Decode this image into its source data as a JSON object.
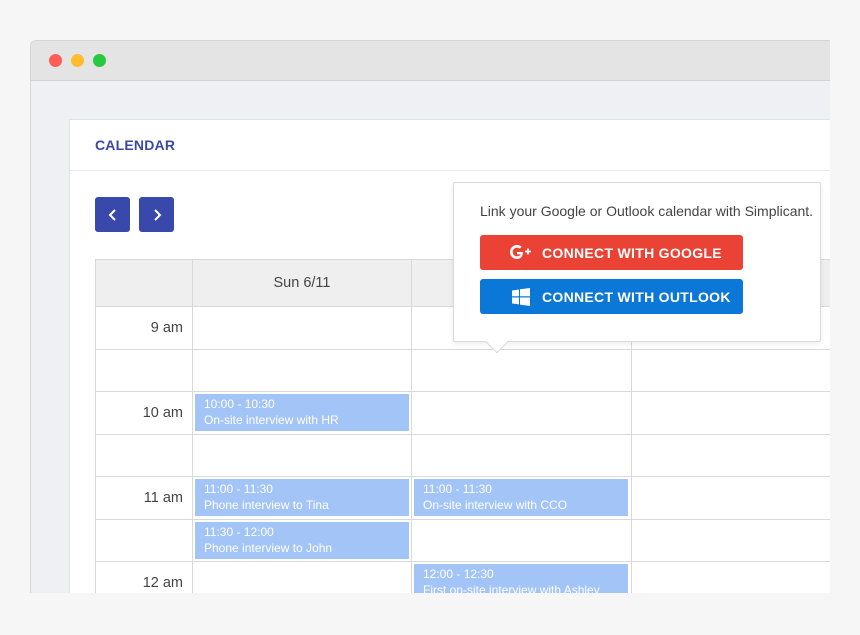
{
  "calendar": {
    "title": "CALENDAR"
  },
  "days": [
    "Sun 6/11",
    "",
    ""
  ],
  "times": [
    "9 am",
    "10 am",
    "11 am",
    "12 am"
  ],
  "events": [
    {
      "time": "10:00 - 10:30",
      "title": "On-site interview with HR"
    },
    {
      "time": "11:00 - 11:30",
      "title": "Phone interview to Tina"
    },
    {
      "time": "11:30 - 12:00",
      "title": "Phone interview to John"
    },
    {
      "time": "11:00 - 11:30",
      "title": "On-site interview with CCO"
    },
    {
      "time": "12:00 - 12:30",
      "title": "First on-site interview with Ashley"
    }
  ],
  "popover": {
    "text": "Link your Google or Outlook calendar with Simplicant.",
    "google_label": "CONNECT WITH GOOGLE",
    "outlook_label": "CONNECT WITH OUTLOOK"
  },
  "icons": {
    "prev": "chevron-left-icon",
    "next": "chevron-right-icon",
    "google": "google-plus-icon",
    "outlook": "windows-icon"
  },
  "colors": {
    "accent": "#3949ab",
    "event": "#a3c4f7",
    "google": "#ea4335",
    "outlook": "#0b78d8"
  }
}
